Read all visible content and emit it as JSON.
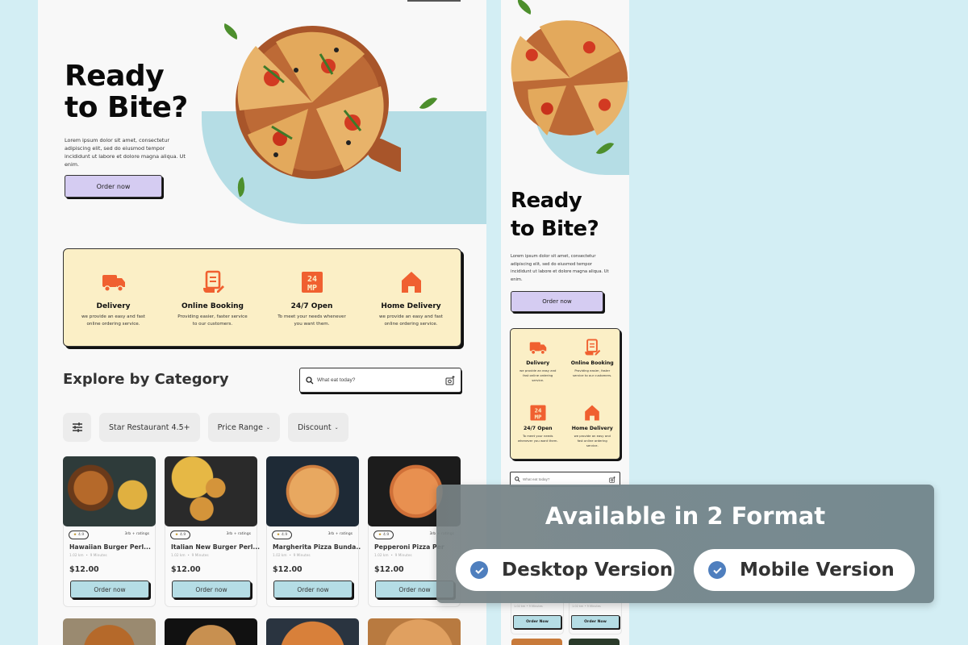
{
  "colors": {
    "page_bg": "#d3eef4",
    "accent_orange": "#f06030",
    "hero_blue": "#b5dde5",
    "feature_bg": "#fbefc6",
    "button_purple": "#d5ccf2",
    "check_blue": "#4f7fbe"
  },
  "desktop": {
    "hero": {
      "title_line1": "Ready",
      "title_line2": "to Bite?",
      "description": "Lorem ipsum dolor sit amet, consectetur adipiscing elit, sed do eiusmod tempor incididunt ut labore et dolore magna aliqua. Ut enim.",
      "order_button": "Order now",
      "image": "pizza-board-image"
    },
    "features": [
      {
        "icon": "delivery-truck-icon",
        "title": "Delivery",
        "description": "we provide an easy and fast online ordering service."
      },
      {
        "icon": "online-booking-icon",
        "title": "Online Booking",
        "description": "Providing easier, faster service to our customers."
      },
      {
        "icon": "24-7-icon",
        "title": "24/7 Open",
        "description": "To meet your needs whenever you want them."
      },
      {
        "icon": "home-icon",
        "title": "Home Delivery",
        "description": "we provide an easy and fast online ordering service."
      }
    ],
    "explore": {
      "title": "Explore by Category",
      "search_placeholder": "What eat today?",
      "filters": [
        {
          "label": "Star Restaurant 4.5+",
          "has_dropdown": false
        },
        {
          "label": "Price Range",
          "has_dropdown": true
        },
        {
          "label": "Discount",
          "has_dropdown": true
        }
      ]
    },
    "products": [
      {
        "name": "Hawaiian Burger Perl...",
        "rating": "4.9",
        "ratings_count": "3rb + ratings",
        "distance": "1.02 km",
        "time": "9 Minutes",
        "price": "$12.00",
        "button": "Order now",
        "image": "burger-fries"
      },
      {
        "name": "Italian New Burger Perl...",
        "rating": "4.9",
        "ratings_count": "3rb + ratings",
        "distance": "1.02 km",
        "time": "9 Minutes",
        "price": "$12.00",
        "button": "Order now",
        "image": "sliders-fries"
      },
      {
        "name": "Margherita Pizza Bunda..",
        "rating": "4.9",
        "ratings_count": "3rb + ratings",
        "distance": "1.02 km",
        "time": "9 Minutes",
        "price": "$12.00",
        "button": "Order now",
        "image": "margherita-pizza"
      },
      {
        "name": "Pepperoni Pizza Per",
        "rating": "4.9",
        "ratings_count": "3rb + ratings",
        "distance": "1.02 km",
        "time": "9 Minutes",
        "price": "$12.00",
        "button": "Order now",
        "image": "sliced-pizza"
      }
    ],
    "meta_separator": "•"
  },
  "mobile": {
    "hero": {
      "title_line1": "Ready",
      "title_line2": "to Bite?",
      "description": "Lorem ipsum dolor sit amet, consectetur adipiscing elit, sed do eiusmod tempor incididunt ut labore et dolore magna aliqua. Ut enim.",
      "order_button": "Order now"
    },
    "features": [
      {
        "title": "Delivery",
        "description": "we provide an easy and fast online ordering service."
      },
      {
        "title": "Online Booking",
        "description": "Providing easier, faster service to our customers."
      },
      {
        "title": "24/7 Open",
        "description": "To meet your needs whenever you want them."
      },
      {
        "title": "Home Delivery",
        "description": "we provide an easy and fast online ordering service."
      }
    ],
    "search_placeholder": "What eat today?",
    "cards": [
      {
        "meta": "1.02 km  •  9 Minutes",
        "button": "Order Now"
      },
      {
        "meta": "1.02 km  •  9 Minutes",
        "button": "Order Now"
      }
    ]
  },
  "overlay": {
    "title": "Available in 2 Format",
    "options": [
      {
        "label": "Desktop Version",
        "checked": true
      },
      {
        "label": "Mobile Version",
        "checked": true
      }
    ]
  }
}
